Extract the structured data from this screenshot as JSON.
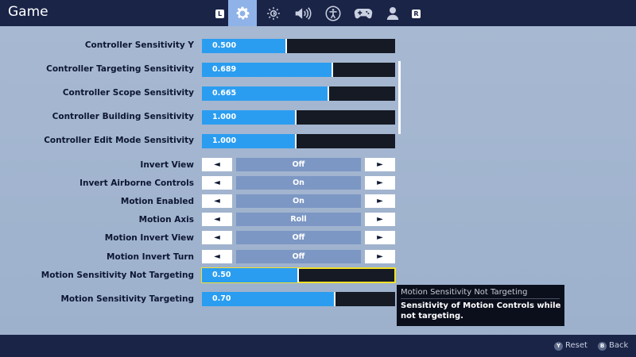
{
  "header": {
    "title": "Game",
    "left_bumper": "L",
    "right_bumper": "R",
    "tabs": [
      {
        "icon": "gear-icon",
        "active": true
      },
      {
        "icon": "brightness-icon",
        "active": false
      },
      {
        "icon": "speaker-icon",
        "active": false
      },
      {
        "icon": "accessibility-icon",
        "active": false
      },
      {
        "icon": "gamepad-icon",
        "active": false
      },
      {
        "icon": "user-icon",
        "active": false
      }
    ]
  },
  "sliders": [
    {
      "label": "Controller Sensitivity Y",
      "value": "0.500",
      "fill": 0.44
    },
    {
      "label": "Controller Targeting Sensitivity",
      "value": "0.689",
      "fill": 0.68
    },
    {
      "label": "Controller Scope Sensitivity",
      "value": "0.665",
      "fill": 0.66
    },
    {
      "label": "Controller Building Sensitivity",
      "value": "1.000",
      "fill": 0.49
    },
    {
      "label": "Controller Edit Mode Sensitivity",
      "value": "1.000",
      "fill": 0.49
    }
  ],
  "options": [
    {
      "label": "Invert View",
      "value": "Off"
    },
    {
      "label": "Invert Airborne Controls",
      "value": "On"
    },
    {
      "label": "Motion Enabled",
      "value": "On"
    },
    {
      "label": "Motion Axis",
      "value": "Roll"
    },
    {
      "label": "Motion Invert View",
      "value": "Off"
    },
    {
      "label": "Motion Invert Turn",
      "value": "Off"
    }
  ],
  "motion_sliders": [
    {
      "label": "Motion Sensitivity Not Targeting",
      "value": "0.50",
      "fill": 0.5
    },
    {
      "label": "Motion Sensitivity Targeting",
      "value": "0.70",
      "fill": 0.69
    }
  ],
  "arrows": {
    "left": "◄",
    "right": "►"
  },
  "tooltip": {
    "title": "Motion Sensitivity Not Targeting",
    "body": "Sensitivity of Motion Controls while not targeting."
  },
  "footer": {
    "reset_button": "Y",
    "reset_label": "Reset",
    "back_button": "B",
    "back_label": "Back"
  },
  "colors": {
    "header_bg": "#1a2447",
    "body_bg": "#a8b9d2",
    "slider_fill": "#2b9df0",
    "focus_outline": "#f2e02a"
  }
}
